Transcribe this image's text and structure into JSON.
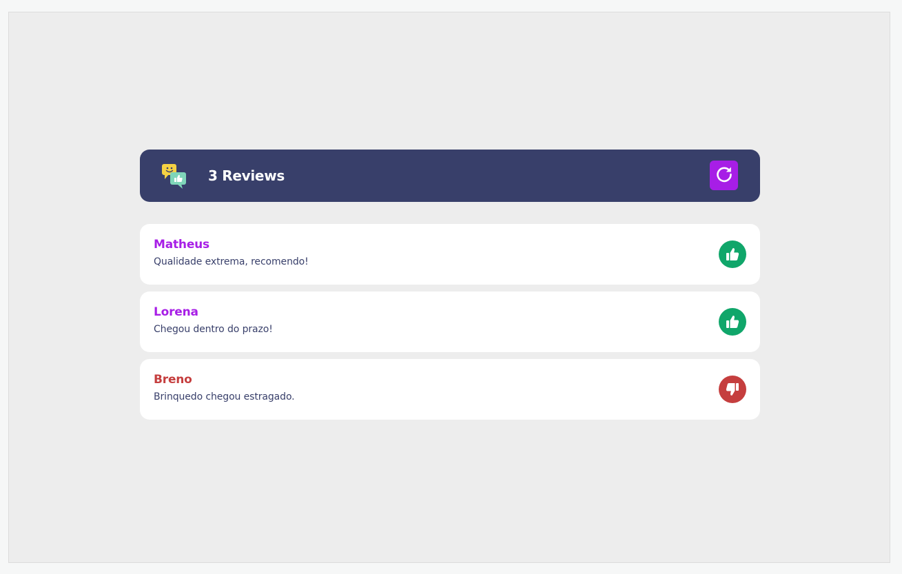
{
  "header": {
    "title": "3 Reviews",
    "icon": "chat-bubbles-icon",
    "refresh_icon": "refresh-icon"
  },
  "colors": {
    "header_bg": "#383f6a",
    "accent": "#a71ee6",
    "positive": "#10a66a",
    "negative": "#c53e3e",
    "text": "#383f6a"
  },
  "reviews": [
    {
      "name": "Matheus",
      "text": "Qualidade extrema, recomendo!",
      "sentiment": "positive",
      "icon": "thumbs-up-icon"
    },
    {
      "name": "Lorena",
      "text": "Chegou dentro do prazo!",
      "sentiment": "positive",
      "icon": "thumbs-up-icon"
    },
    {
      "name": "Breno",
      "text": "Brinquedo chegou estragado.",
      "sentiment": "negative",
      "icon": "thumbs-down-icon"
    }
  ]
}
